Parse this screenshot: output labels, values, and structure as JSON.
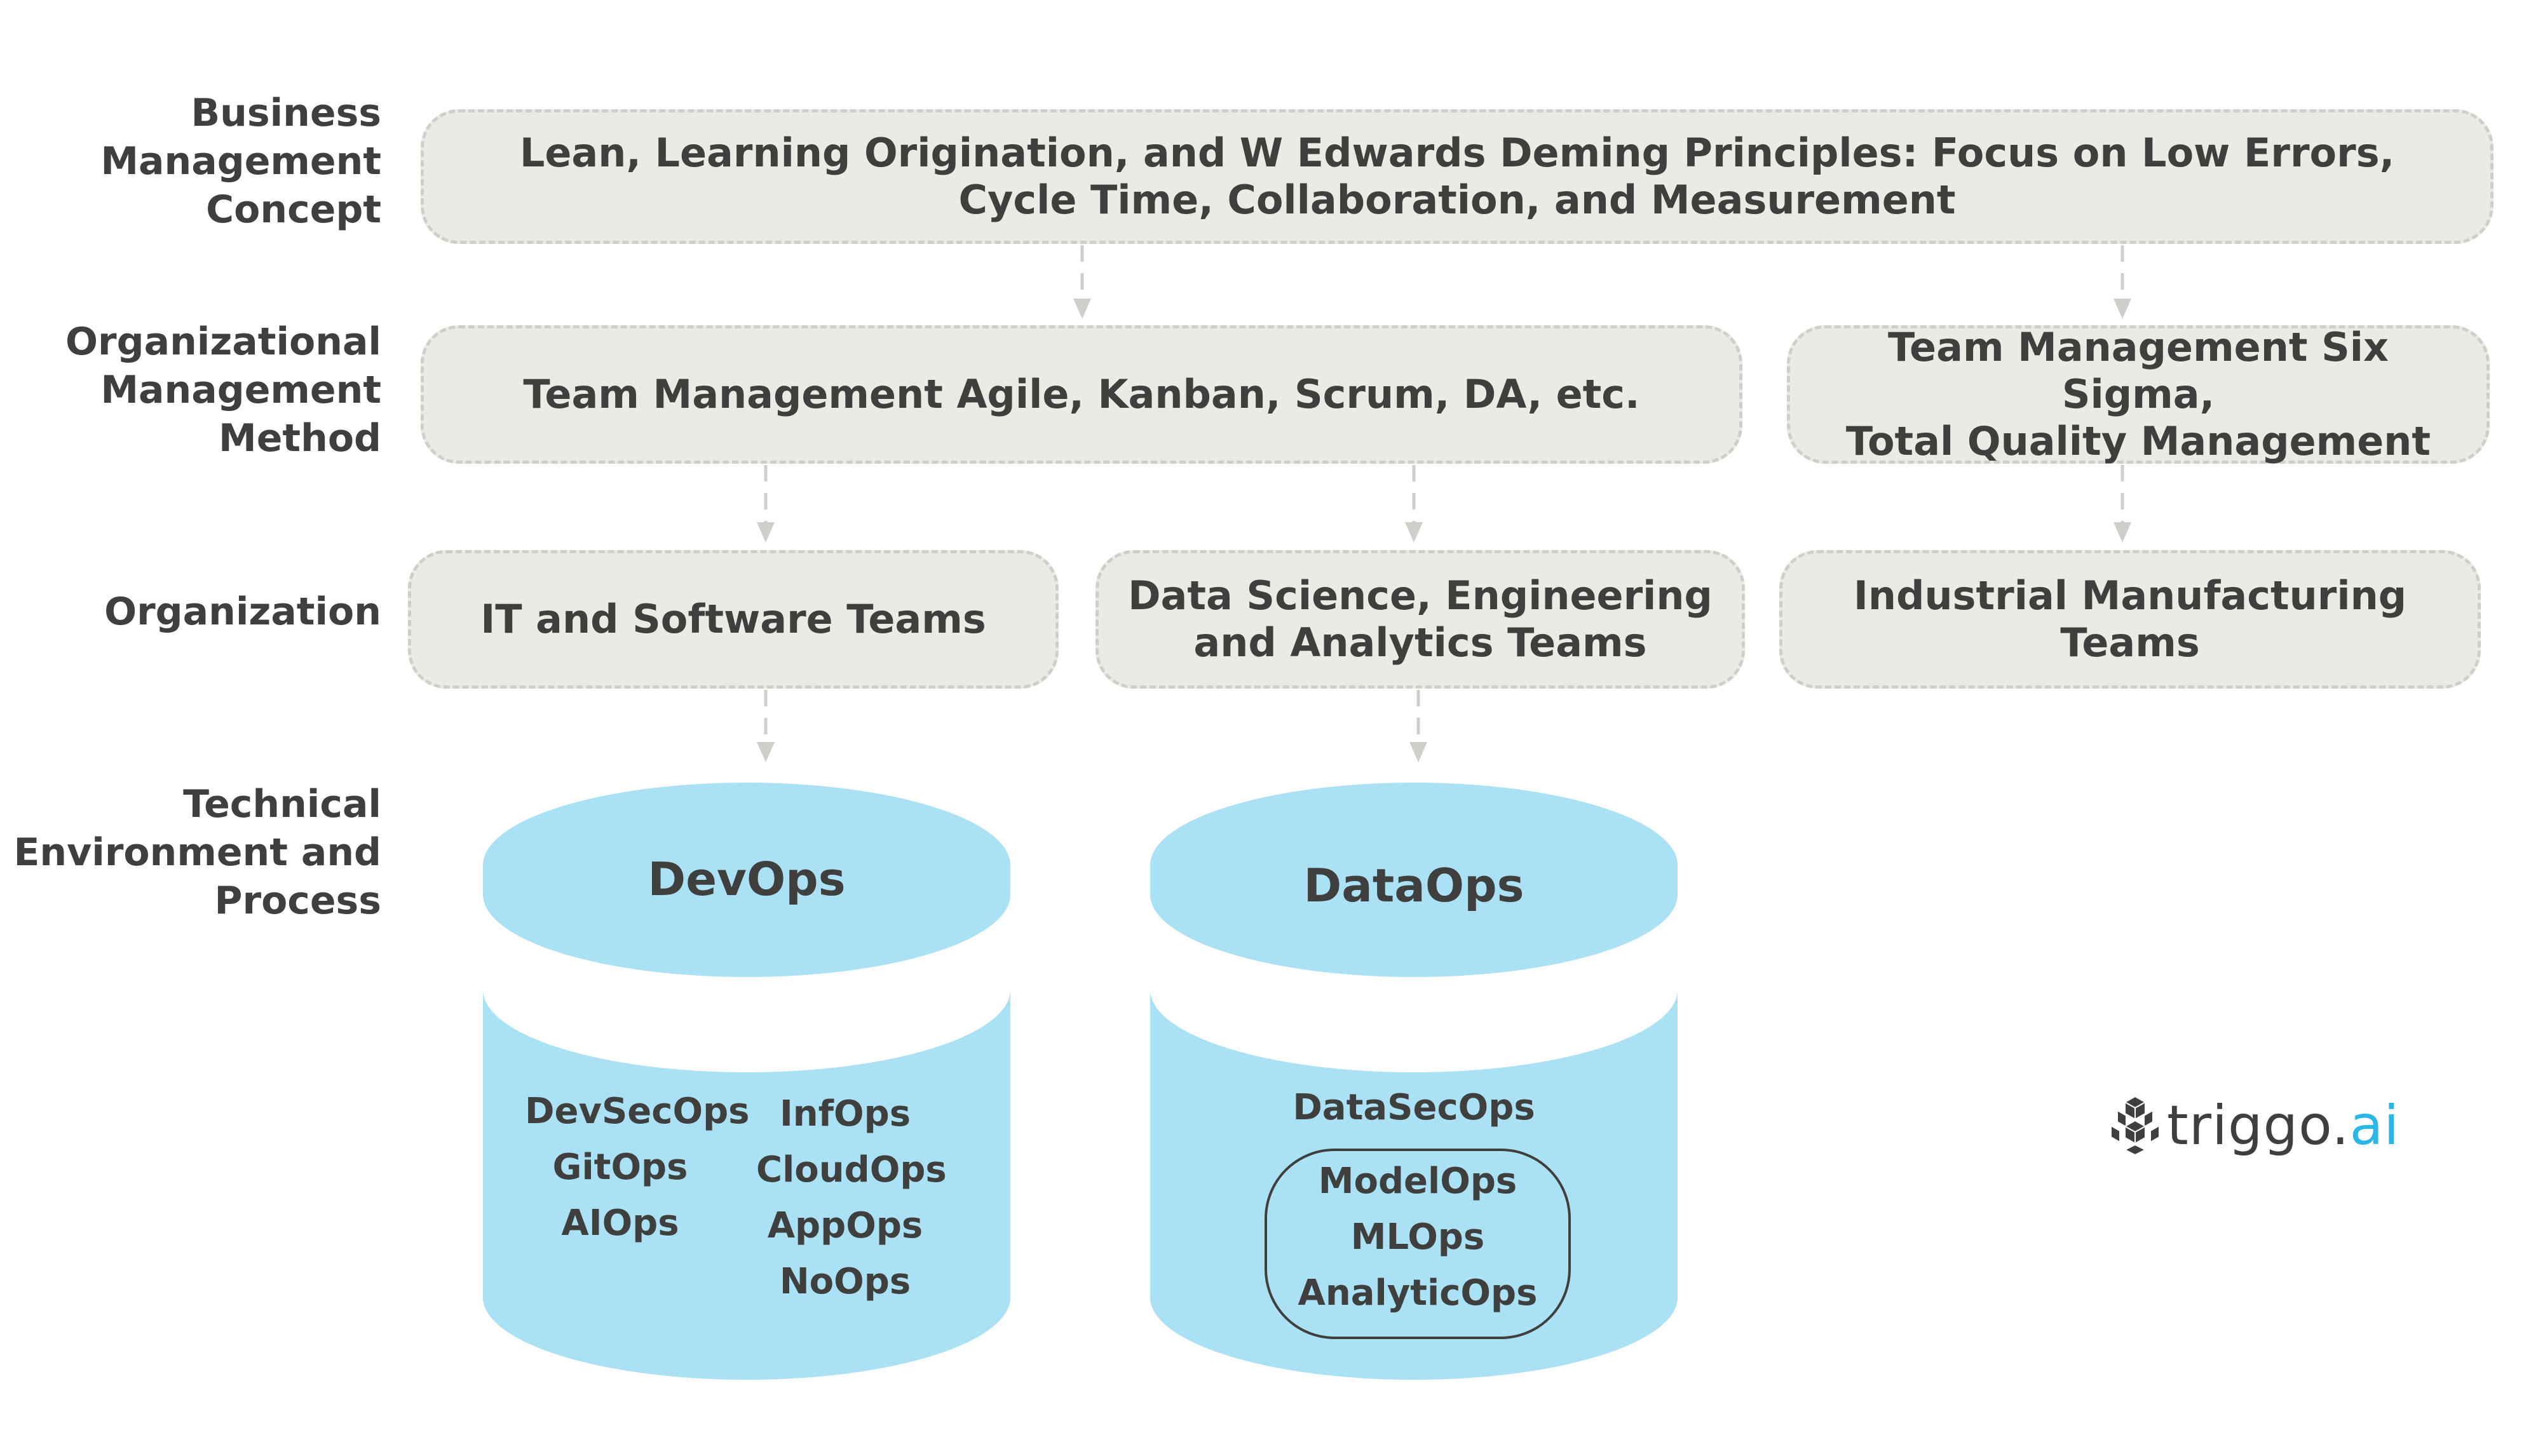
{
  "row_labels": [
    {
      "id": "business",
      "text": "Business\nManagement\nConcept"
    },
    {
      "id": "org-method",
      "text": "Organizational\nManagement\nMethod"
    },
    {
      "id": "organization",
      "text": "Organization"
    },
    {
      "id": "technical",
      "text": "Technical\nEnvironment and\nProcess"
    }
  ],
  "boxes": {
    "concept": "Lean, Learning Origination, and W Edwards Deming Principles: Focus on Low Errors,\nCycle Time, Collaboration, and Measurement",
    "method_agile": "Team Management Agile, Kanban, Scrum, DA, etc.",
    "method_sixsigma": "Team Management Six Sigma,\nTotal Quality Management",
    "org_it": "IT and Software Teams",
    "org_data": "Data Science, Engineering\nand Analytics Teams",
    "org_industrial": "Industrial Manufacturing\nTeams"
  },
  "devops": {
    "title": "DevOps",
    "left": [
      "DevSecOps",
      "GitOps",
      "AIOps"
    ],
    "right": [
      "InfOps",
      "CloudOps",
      "AppOps",
      "NoOps"
    ]
  },
  "dataops": {
    "title": "DataOps",
    "top": "DataSecOps",
    "group": [
      "ModelOps",
      "MLOps",
      "AnalyticOps"
    ]
  },
  "logo": {
    "text_main": "triggo.",
    "text_accent": "ai"
  },
  "colors": {
    "box_fill": "#ebebe5",
    "box_border": "#cfcfc9",
    "cylinder": "#aae1f5",
    "text": "#3f3f3d",
    "accent": "#29b6e8"
  }
}
